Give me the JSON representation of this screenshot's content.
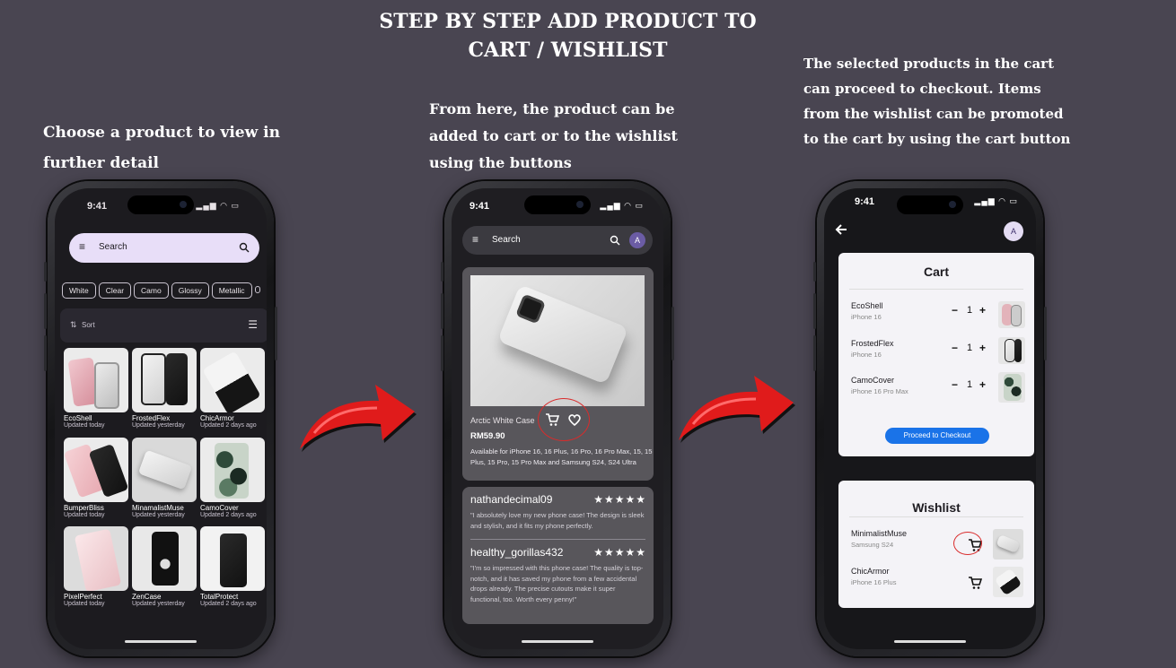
{
  "title": "STEP BY STEP ADD PRODUCT TO CART / WISHLIST",
  "captions": {
    "step1": "Choose a product to view in further detail",
    "step2": "From here, the product can be added to cart or to the wishlist using the buttons",
    "step3": "The selected products in the cart can proceed to checkout. Items from the wishlist can be promoted to the cart by using the cart button"
  },
  "phone1": {
    "time": "9:41",
    "search_placeholder": "Search",
    "chips": [
      "White",
      "Clear",
      "Camo",
      "Glossy",
      "Metallic"
    ],
    "sort_label": "Sort",
    "products": [
      {
        "name": "EcoShell",
        "updated": "Updated today"
      },
      {
        "name": "FrostedFlex",
        "updated": "Updated yesterday"
      },
      {
        "name": "ChicArmor",
        "updated": "Updated 2 days ago"
      },
      {
        "name": "BumperBliss",
        "updated": "Updated today"
      },
      {
        "name": "MinamalistMuse",
        "updated": "Updated yesterday"
      },
      {
        "name": "CamoCover",
        "updated": "Updated 2 days ago"
      },
      {
        "name": "PixelPerfect",
        "updated": "Updated today"
      },
      {
        "name": "ZenCase",
        "updated": "Updated yesterday"
      },
      {
        "name": "TotalProtect",
        "updated": "Updated 2 days ago"
      }
    ]
  },
  "phone2": {
    "time": "9:41",
    "search_placeholder": "Search",
    "avatar": "A",
    "product": {
      "name": "Arctic White Case",
      "price": "RM59.90",
      "availability": "Available for iPhone 16, 16 Plus, 16 Pro, 16 Pro Max, 15, 15 Plus, 15 Pro, 15 Pro Max and Samsung S24, S24 Ultra"
    },
    "reviews": [
      {
        "user": "nathandecimal09",
        "stars": "★★★★★",
        "text": "\"I absolutely love my new phone case! The design is sleek and stylish, and it fits my phone perfectly."
      },
      {
        "user": "healthy_gorillas432",
        "stars": "★★★★★",
        "text": "\"I'm so impressed with this phone case! The quality is top-notch, and it has saved my phone from a few accidental drops already. The precise cutouts make it super functional, too. Worth every penny!\""
      }
    ]
  },
  "phone3": {
    "time": "9:41",
    "avatar": "A",
    "cart_title": "Cart",
    "cart_items": [
      {
        "name": "EcoShell",
        "model": "iPhone 16",
        "qty": "1"
      },
      {
        "name": "FrostedFlex",
        "model": "iPhone 16",
        "qty": "1"
      },
      {
        "name": "CamoCover",
        "model": "iPhone 16 Pro Max",
        "qty": "1"
      }
    ],
    "checkout_label": "Proceed to Checkout",
    "wishlist_title": "Wishlist",
    "wishlist_items": [
      {
        "name": "MinimalistMuse",
        "model": "Samsung S24"
      },
      {
        "name": "ChicArmor",
        "model": "iPhone 16 Plus"
      }
    ]
  },
  "colors": {
    "background": "#494551",
    "accent": "#1a73e8",
    "highlight": "#d92b2b",
    "arrow": "#e01b1b"
  }
}
